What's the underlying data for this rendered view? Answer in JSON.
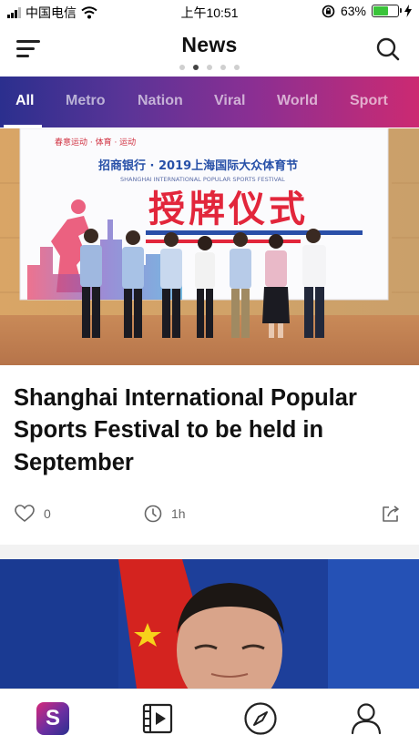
{
  "status_bar": {
    "carrier": "中国电信",
    "time": "上午10:51",
    "battery": "63%",
    "battery_level": 0.63
  },
  "header": {
    "title": "News"
  },
  "tabs": [
    {
      "label": "All",
      "active": true
    },
    {
      "label": "Metro",
      "active": false
    },
    {
      "label": "Nation",
      "active": false
    },
    {
      "label": "Viral",
      "active": false
    },
    {
      "label": "World",
      "active": false
    },
    {
      "label": "Sport",
      "active": false
    }
  ],
  "articles": [
    {
      "image_banner": {
        "top_line": "招商银行 · 2019上海国际大众体育节",
        "subtitle": "SHANGHAI INTERNATIONAL POPULAR SPORTS FESTIVAL",
        "main_text": "授牌仪式"
      },
      "headline": "Shanghai International Popular Sports Festival to be held in September",
      "likes": "0",
      "time_ago": "1h"
    }
  ],
  "bottom_nav": {
    "logo_letter": "S"
  },
  "colors": {
    "tab_gradient_start": "#2b2f8e",
    "tab_gradient_end": "#cc2a72",
    "accent": "#5a3497"
  }
}
